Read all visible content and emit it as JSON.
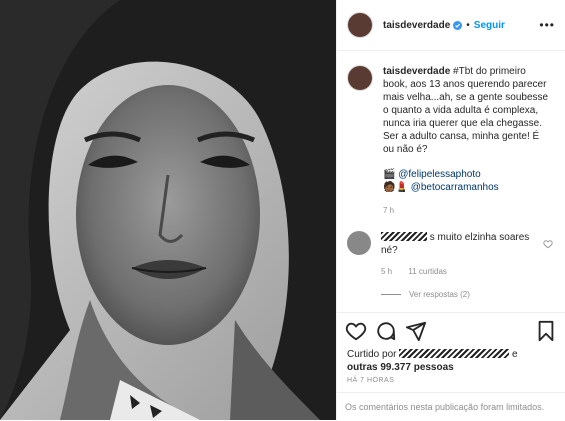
{
  "post": {
    "username": "taisdeverdade",
    "follow_label": "Seguir",
    "more_label": "•••",
    "caption": {
      "username": "taisdeverdade",
      "text": "#Tbt do primeiro book, aos 13 anos querendo parecer mais velha...ah, se a gente soubesse o quanto a vida adulta é complexa, nunca iria querer que ela chegasse. Ser a adulto cansa, minha gente! É ou não é?",
      "credit1_emoji": "🎬",
      "credit1": "@felipelessaphoto",
      "credit2_emoji": "🧑🏾💄",
      "credit2": "@betocarramanhos",
      "time": "7 h"
    },
    "comment": {
      "text_after_redaction": "s muito elzinha soares né?",
      "time": "5 h",
      "likes": "11 curtidas",
      "replies": "Ver respostas (2)"
    },
    "likes_line": {
      "prefix": "Curtido por",
      "suffix": "e",
      "count": "outras 99.377 pessoas"
    },
    "posted_ago": "HÁ 7 HORAS",
    "footer": "Os comentários nesta publicação foram limitados."
  },
  "colors": {
    "link": "#0095f6",
    "tag": "#00376b",
    "muted": "#8e8e8e"
  },
  "icons": [
    "more-icon",
    "verified-icon",
    "heart-icon",
    "comment-icon",
    "share-icon",
    "save-icon"
  ]
}
